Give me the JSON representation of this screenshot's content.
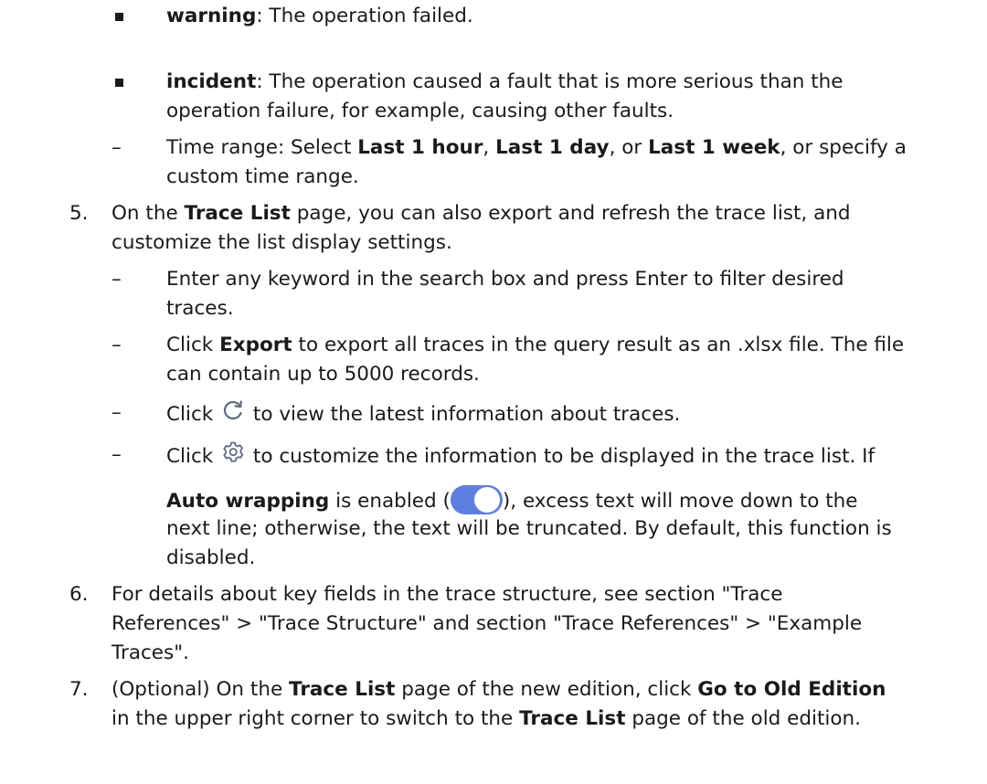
{
  "items": {
    "warning": {
      "term": "warning",
      "desc": ": The operation failed."
    },
    "incident": {
      "term": "incident",
      "line1": ": The operation caused a fault that is more serious than the",
      "line2": "operation failure, for example, causing other faults."
    },
    "time_range": {
      "lead": "Time range: Select ",
      "opt1": "Last 1 hour",
      "sep1": ", ",
      "opt2": "Last 1 day",
      "sep2": ", or ",
      "opt3": "Last 1 week",
      "tail": ", or specify a",
      "line2": "custom time range."
    },
    "step5": {
      "num": "5.",
      "pre": "On the ",
      "page": "Trace List",
      "post": " page, you can also export and refresh the trace list, and",
      "line2": "customize the list display settings."
    },
    "search": {
      "line1": "Enter any keyword in the search box and press Enter to filter desired",
      "line2": "traces."
    },
    "export": {
      "pre": "Click ",
      "btn": "Export",
      "post": " to export all traces in the query result as an .xlsx file. The file",
      "line2": "can contain up to 5000 records."
    },
    "refresh": {
      "pre": "Click ",
      "post": " to view the latest information about traces.",
      "icon": "refresh-icon"
    },
    "settings": {
      "pre": "Click ",
      "post": " to customize the information to be displayed in the trace list. If",
      "icon": "gear-icon",
      "wrap": "Auto wrapping",
      "wrap_post1": " is enabled (",
      "wrap_post2": "), excess text will move down to the",
      "line3": "next line; otherwise, the text will be truncated. By default, this function is",
      "line4": "disabled."
    },
    "step6": {
      "num": "6.",
      "line1": "For details about key fields in the trace structure, see section \"Trace",
      "line2": "References\" > \"Trace Structure\" and section \"Trace References\" > \"Example",
      "line3": "Traces\"."
    },
    "step7": {
      "num": "7.",
      "pre": "(Optional) On the ",
      "page": "Trace List",
      "mid": " page of the new edition, click ",
      "btn": "Go to Old Edition",
      "line2_pre": "in the upper right corner to switch to the ",
      "page2": "Trace List",
      "line2_post": " page of the old edition."
    }
  },
  "dash_char": "–",
  "toggle_color": "#5f7fe0"
}
